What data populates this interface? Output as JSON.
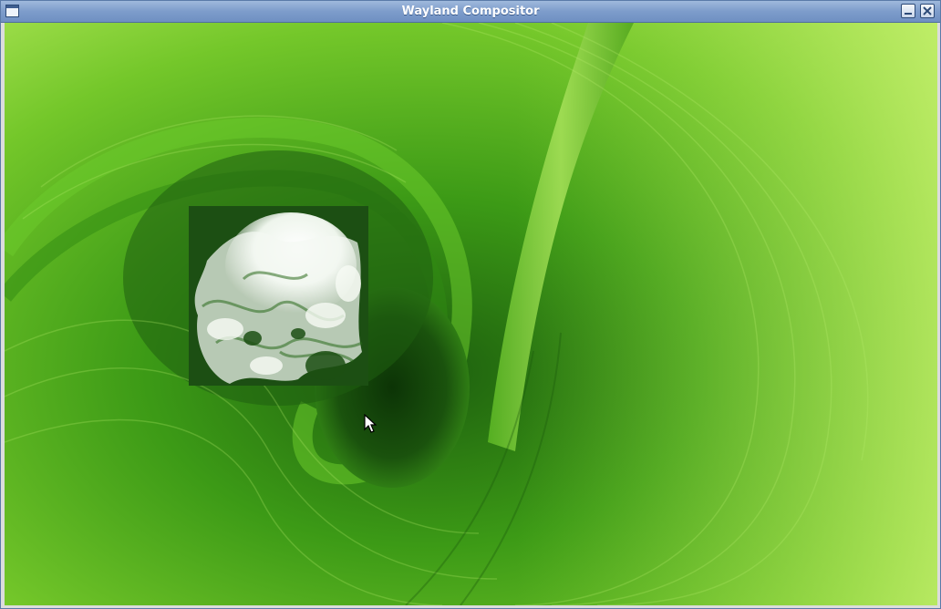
{
  "window": {
    "title": "Wayland Compositor"
  },
  "titlebar_icons": {
    "menu": "window-menu-icon",
    "minimize": "minimize-icon",
    "close": "close-icon"
  },
  "colors": {
    "titlebar": "#7d9ccb",
    "leaf_light": "#a6e64a",
    "leaf_dark": "#1e6a12",
    "smoke": "#ffffff"
  },
  "desktop": {
    "wallpaper": "green leaf spiral",
    "client_surface": "smoke client"
  }
}
